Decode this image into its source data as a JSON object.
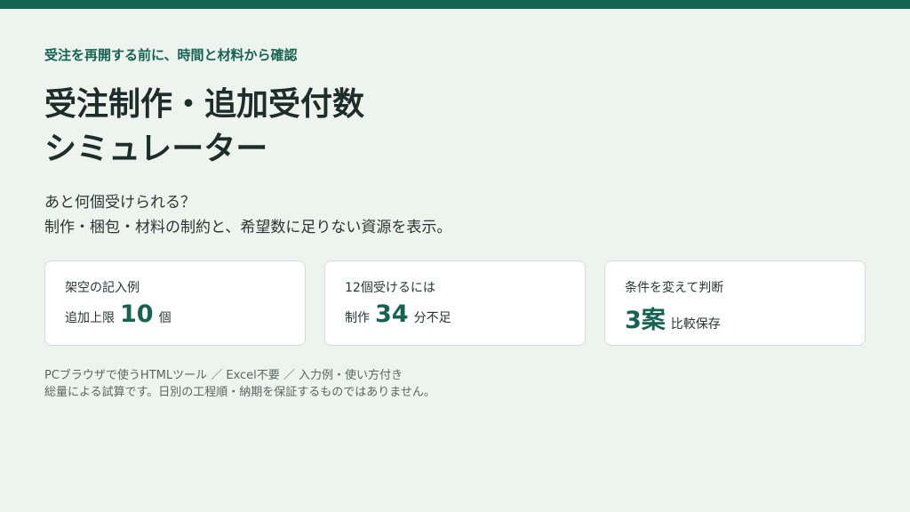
{
  "eyebrow": "受注を再開する前に、時間と材料から確認",
  "title": {
    "line1": "受注制作・追加受付数",
    "line2": "シミュレーター"
  },
  "description": {
    "line1": "あと何個受けられる？",
    "line2": "制作・梱包・材料の制約と、希望数に足りない資源を表示。"
  },
  "cards": [
    {
      "label": "架空の記入例",
      "prefix": "追加上限",
      "value": "10",
      "suffix": "個"
    },
    {
      "label": "12個受けるには",
      "prefix": "制作",
      "value": "34",
      "suffix": "分不足"
    },
    {
      "label": "条件を変えて判断",
      "prefix": "",
      "value": "3案",
      "suffix": "比較保存"
    }
  ],
  "footer": {
    "line1": "PCブラウザで使うHTMLツール ／ Excel不要 ／ 入力例・使い方付き",
    "line2": "総量による試算です。日別の工程順・納期を保証するものではありません。"
  },
  "colors": {
    "accent": "#176352",
    "background": "#edf3ee",
    "card": "#ffffff"
  }
}
